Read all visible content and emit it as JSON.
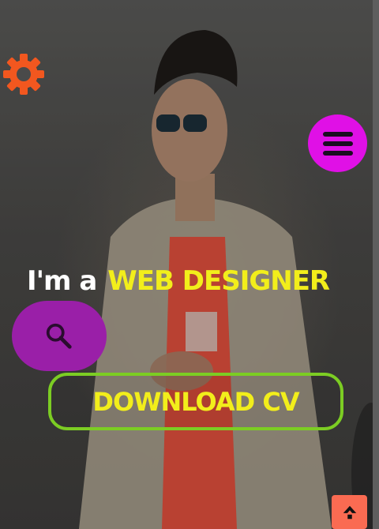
{
  "hero": {
    "lead": "I'm a",
    "role": "WEB DESIGNER"
  },
  "buttons": {
    "download": "DOWNLOAD CV"
  },
  "icons": {
    "settings": "gear-icon",
    "menu": "hamburger-menu-icon",
    "search": "search-icon",
    "scroll_top": "scroll-to-top-icon"
  },
  "colors": {
    "accent_yellow": "#f2ee1b",
    "menu_magenta": "#e010e6",
    "search_purple": "#9a1fa8",
    "download_border_green": "#7ccd23",
    "scroll_top_orange": "#fa6b52",
    "gear_orange": "#f2571f"
  }
}
